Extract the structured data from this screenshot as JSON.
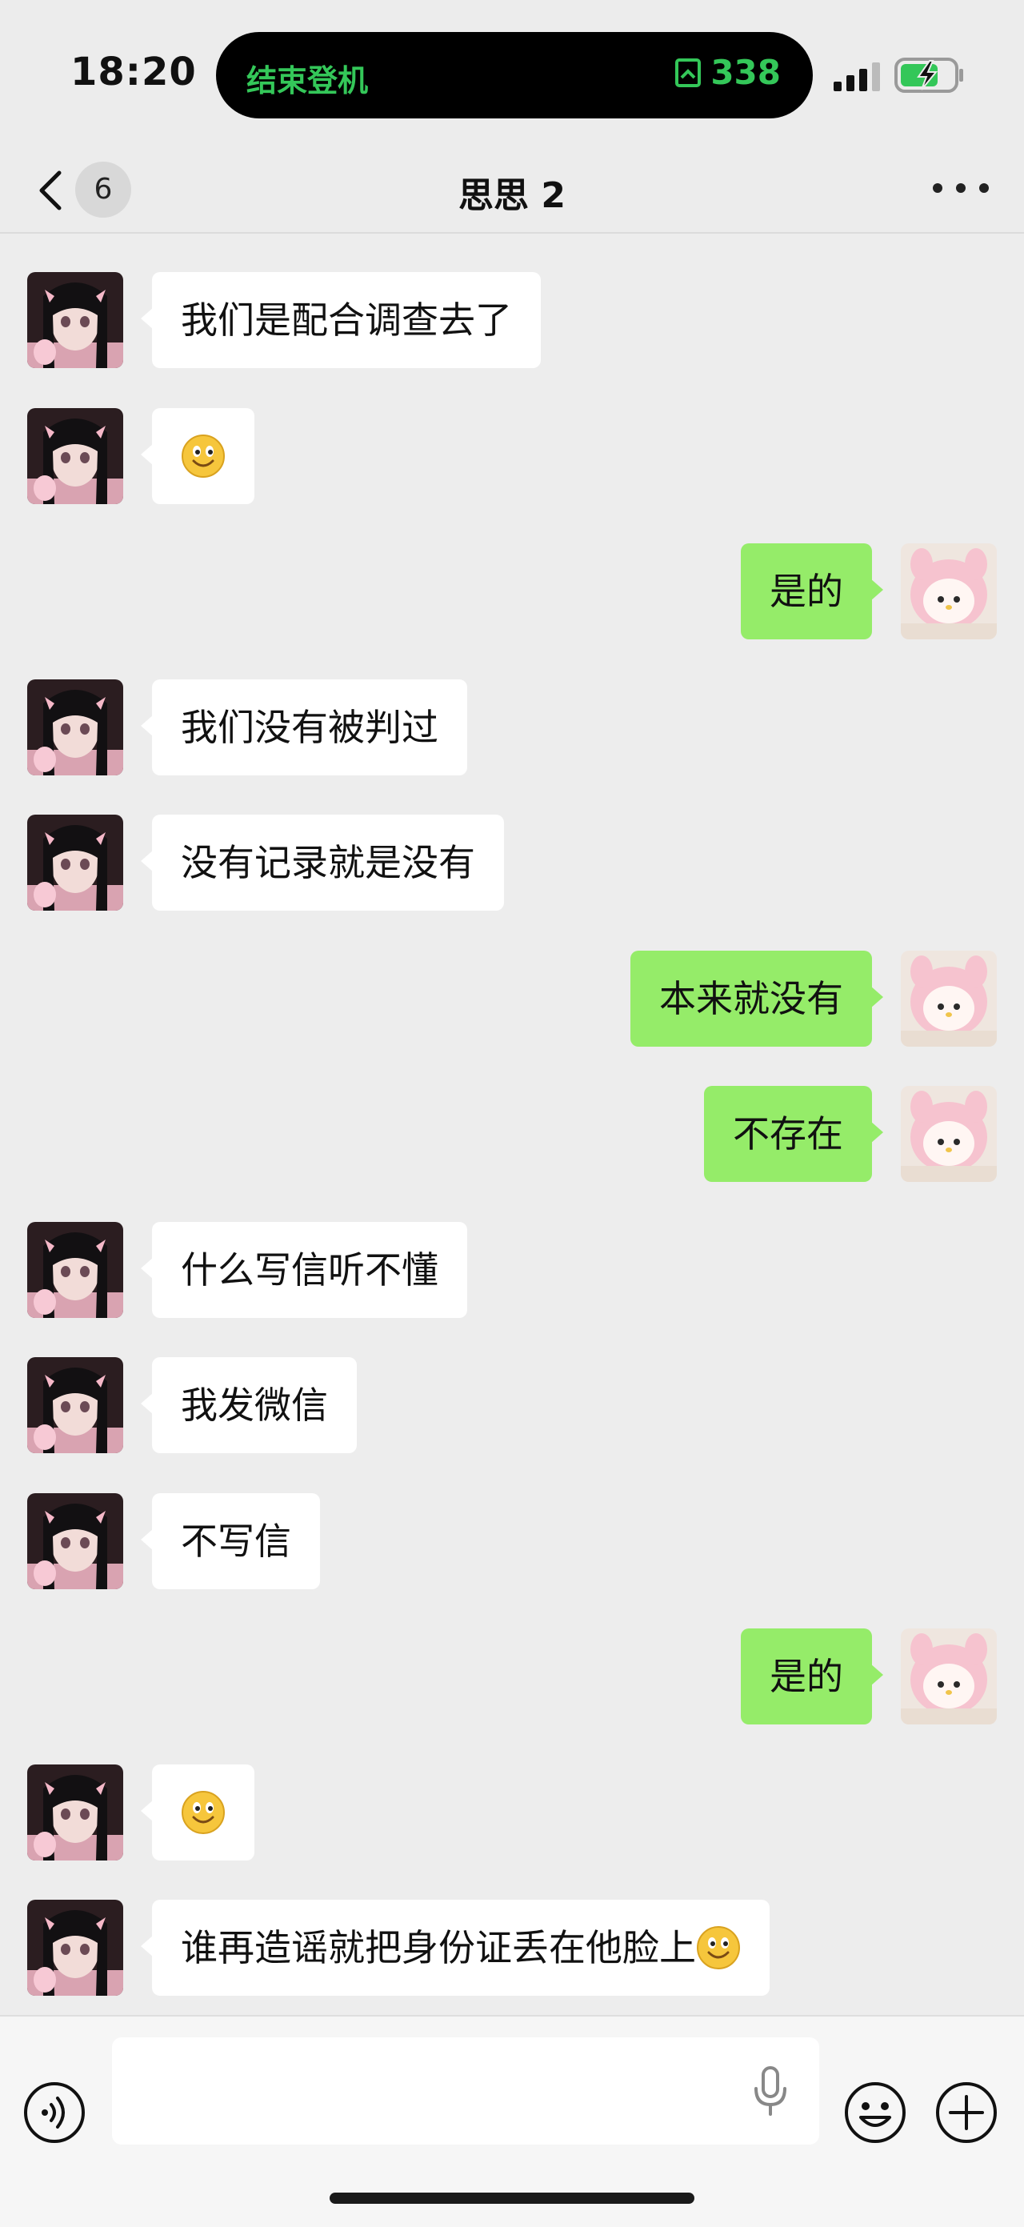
{
  "status_bar": {
    "time": "18:20",
    "island_label": "结束登机",
    "island_seat": "338"
  },
  "nav": {
    "unread_count": "6",
    "title": "思思 2"
  },
  "messages": [
    {
      "side": "left",
      "text": "我们是配合调查去了",
      "emoji": false
    },
    {
      "side": "left",
      "text": "",
      "emoji": true
    },
    {
      "side": "right",
      "text": "是的",
      "emoji": false
    },
    {
      "side": "left",
      "text": "我们没有被判过",
      "emoji": false
    },
    {
      "side": "left",
      "text": "没有记录就是没有",
      "emoji": false
    },
    {
      "side": "right",
      "text": "本来就没有",
      "emoji": false
    },
    {
      "side": "right",
      "text": "不存在",
      "emoji": false
    },
    {
      "side": "left",
      "text": "什么写信听不懂",
      "emoji": false
    },
    {
      "side": "left",
      "text": "我发微信",
      "emoji": false
    },
    {
      "side": "left",
      "text": "不写信",
      "emoji": false
    },
    {
      "side": "right",
      "text": "是的",
      "emoji": false
    },
    {
      "side": "left",
      "text": "",
      "emoji": true
    },
    {
      "side": "left",
      "text": "谁再造谣就把身份证丢在他脸上",
      "emoji": true
    }
  ],
  "icons": {
    "back": "chevron-left-icon",
    "more": "more-dots-icon",
    "voice": "voice-icon",
    "mic": "microphone-icon",
    "emoji": "emoji-icon",
    "plus": "plus-icon",
    "smiley": "smiley-emoji"
  },
  "colors": {
    "background": "#ededed",
    "incoming_bubble": "#ffffff",
    "outgoing_bubble": "#95ec69",
    "island_accent": "#34c759"
  }
}
